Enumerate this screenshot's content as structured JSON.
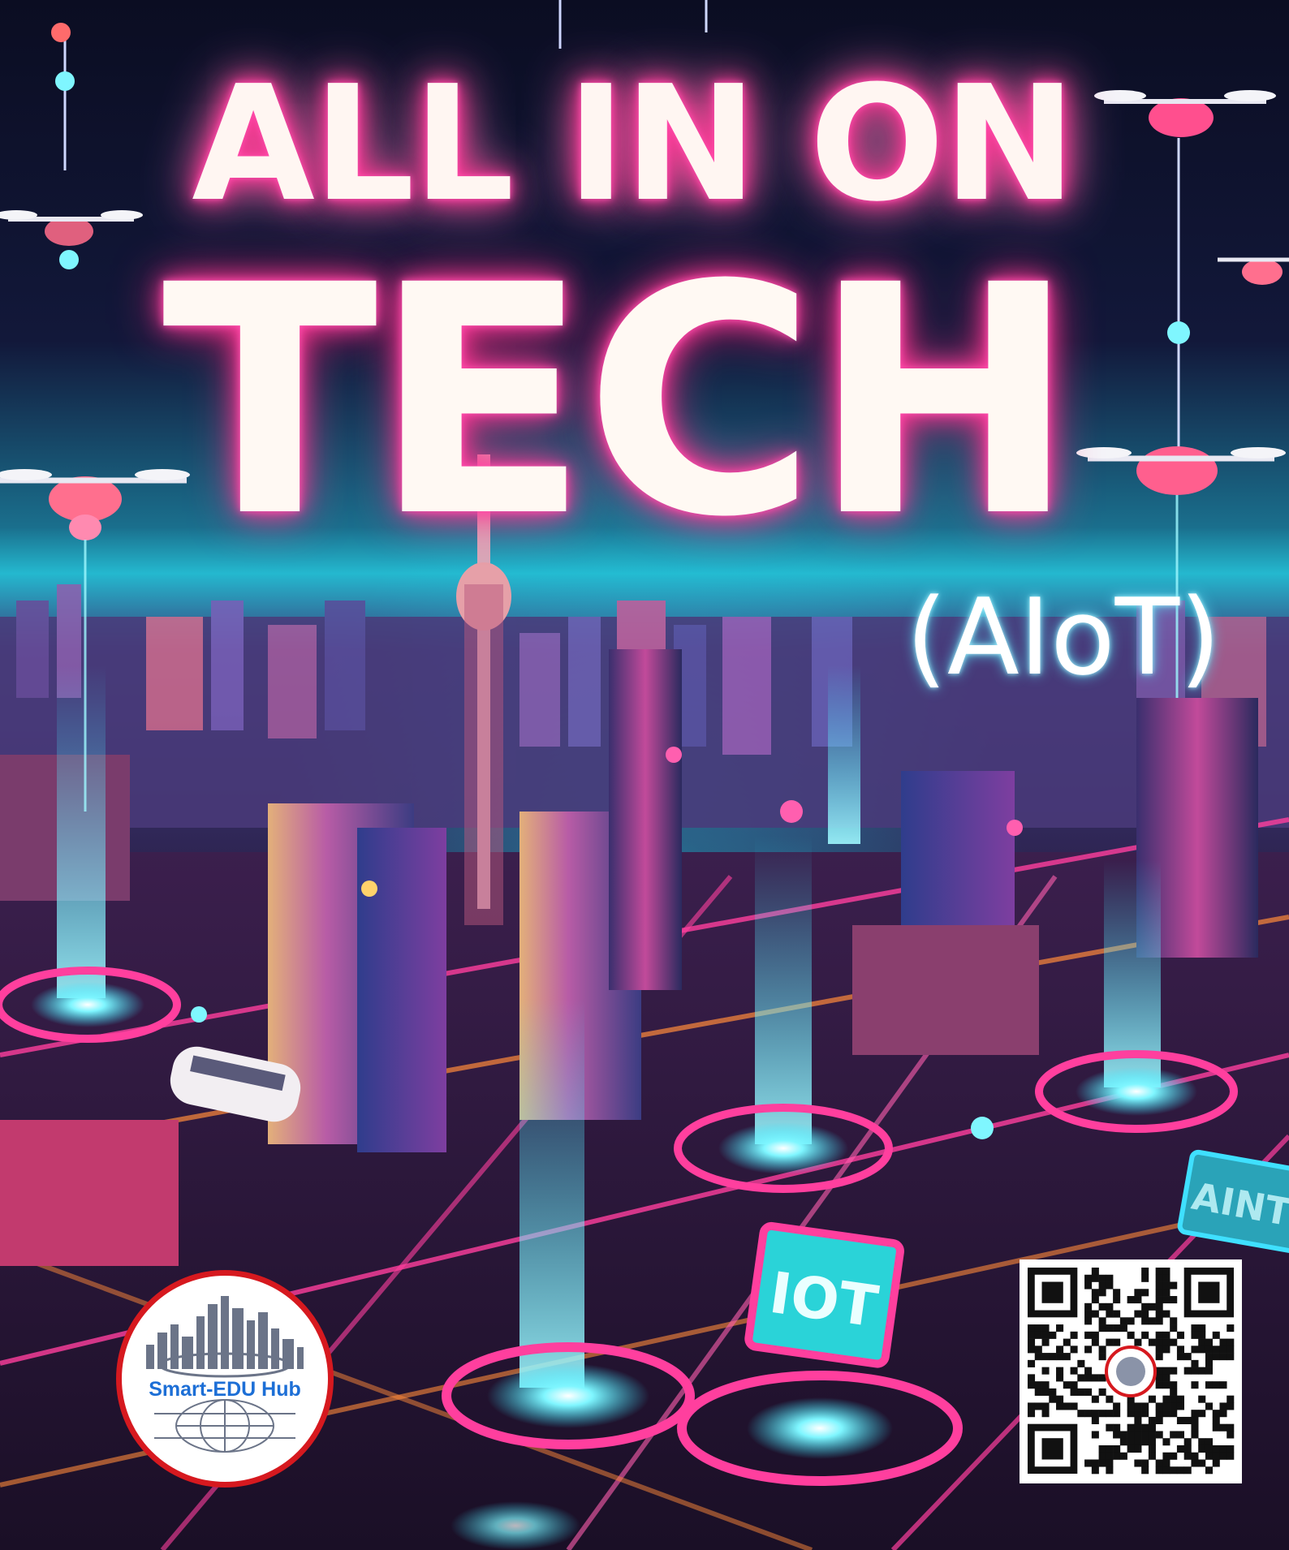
{
  "title": {
    "line1": "ALL IN ON",
    "line2": "TECH",
    "line3": "(AIoT)"
  },
  "signs": {
    "iot": "IOT",
    "right": "AINT"
  },
  "logo": {
    "text": "Smart-EDU Hub"
  },
  "colors": {
    "neon_pink": "#ff3f9e",
    "neon_cyan": "#2fe6ff",
    "title_white": "#fff6f2",
    "logo_ring": "#d6191f",
    "logo_text": "#1d6fd6"
  }
}
